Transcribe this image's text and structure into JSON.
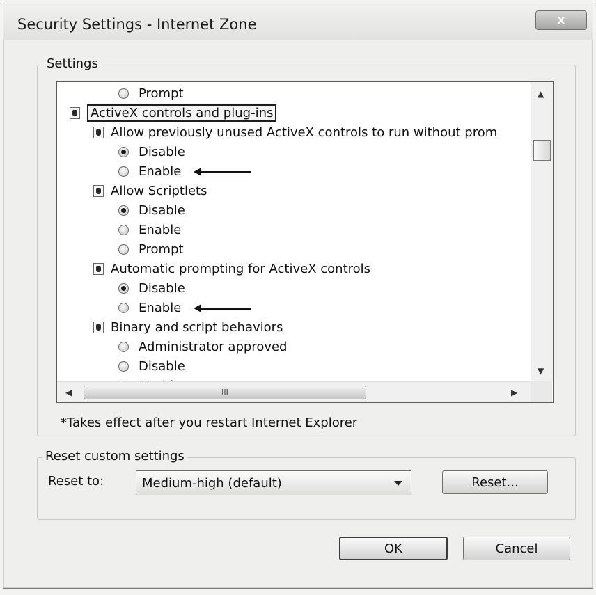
{
  "window": {
    "title": "Security Settings - Internet Zone",
    "close_glyph": "x"
  },
  "settings": {
    "group_label": "Settings",
    "items": [
      {
        "kind": "radio",
        "label": "Prompt",
        "checked": false
      },
      {
        "kind": "category",
        "label": "ActiveX controls and plug-ins",
        "focused": true
      },
      {
        "kind": "setting",
        "label": "Allow previously unused ActiveX controls to run without prom"
      },
      {
        "kind": "radio",
        "label": "Disable",
        "checked": true
      },
      {
        "kind": "radio",
        "label": "Enable",
        "checked": false,
        "arrow": true
      },
      {
        "kind": "setting",
        "label": "Allow Scriptlets"
      },
      {
        "kind": "radio",
        "label": "Disable",
        "checked": true
      },
      {
        "kind": "radio",
        "label": "Enable",
        "checked": false
      },
      {
        "kind": "radio",
        "label": "Prompt",
        "checked": false
      },
      {
        "kind": "setting",
        "label": "Automatic prompting for ActiveX controls"
      },
      {
        "kind": "radio",
        "label": "Disable",
        "checked": true
      },
      {
        "kind": "radio",
        "label": "Enable",
        "checked": false,
        "arrow": true
      },
      {
        "kind": "setting",
        "label": "Binary and script behaviors"
      },
      {
        "kind": "radio",
        "label": "Administrator approved",
        "checked": false
      },
      {
        "kind": "radio",
        "label": "Disable",
        "checked": false
      },
      {
        "kind": "radio",
        "label": "Enable",
        "checked": true
      }
    ],
    "hscroll_grip": "III",
    "note": "*Takes effect after you restart Internet Explorer"
  },
  "reset": {
    "group_label": "Reset custom settings",
    "reset_to_label": "Reset to:",
    "selected_level": "Medium-high (default)",
    "reset_button": "Reset..."
  },
  "footer": {
    "ok_button": "OK",
    "cancel_button": "Cancel"
  },
  "icons": {
    "category": "settings-category-icon",
    "radio": "radio-button",
    "annotation": "arrow-left-icon"
  }
}
